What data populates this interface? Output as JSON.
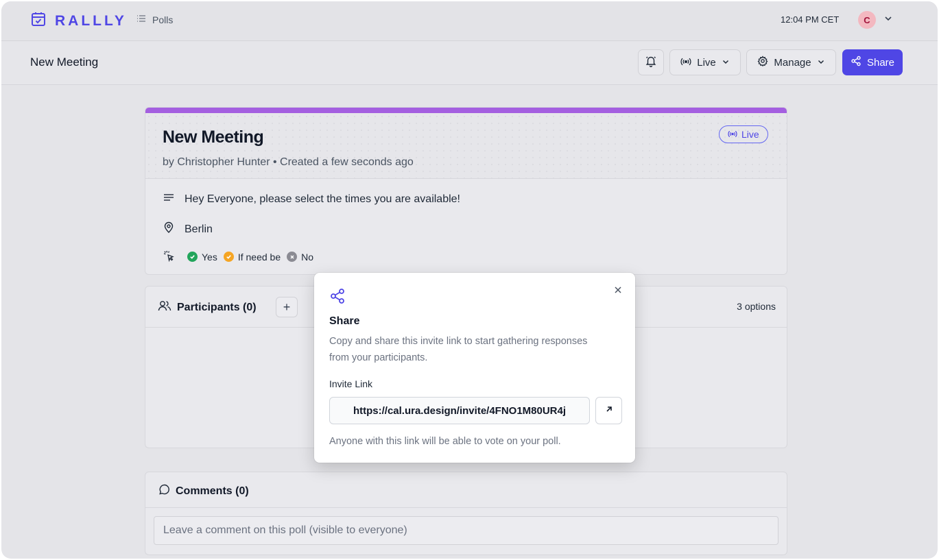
{
  "app": {
    "logo_text": "RALLLY",
    "nav_polls": "Polls",
    "time": "12:04 PM CET",
    "user_initial": "C"
  },
  "toolbar": {
    "page_title": "New Meeting",
    "live_label": "Live",
    "manage_label": "Manage",
    "share_label": "Share"
  },
  "poll": {
    "title": "New Meeting",
    "author": "by Christopher Hunter",
    "created": "Created a few seconds ago",
    "status": "Live",
    "description": "Hey Everyone, please select the times you are available!",
    "location": "Berlin",
    "legend": {
      "yes": "Yes",
      "if_need_be": "If need be",
      "no": "No"
    }
  },
  "participants": {
    "title": "Participants (0)",
    "options_count": "3 options"
  },
  "comments": {
    "title": "Comments (0)",
    "placeholder": "Leave a comment on this poll (visible to everyone)"
  },
  "share_dialog": {
    "title": "Share",
    "description": "Copy and share this invite link to start gathering responses from your participants.",
    "invite_label": "Invite Link",
    "invite_url": "https://cal.ura.design/invite/4FNO1M80UR4j",
    "footer": "Anyone with this link will be able to vote on your poll."
  },
  "colors": {
    "brand": "#4f46e5",
    "stripe": "#a45fe0",
    "yes": "#22a55b",
    "if_need_be": "#f5a524",
    "no": "#8b8b93"
  }
}
